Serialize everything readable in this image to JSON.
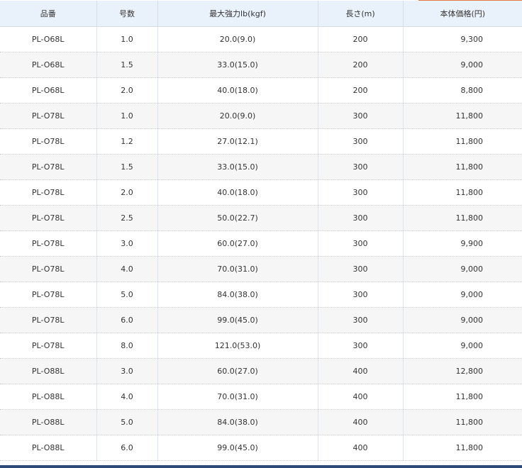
{
  "table": {
    "headers": [
      "品番",
      "号数",
      "最大強力lb(kgf)",
      "長さ(m)",
      "本体価格(円)"
    ],
    "rows": [
      [
        "PL-O68L",
        "1.0",
        "20.0(9.0)",
        "200",
        "9,300"
      ],
      [
        "PL-O68L",
        "1.5",
        "33.0(15.0)",
        "200",
        "9,000"
      ],
      [
        "PL-O68L",
        "2.0",
        "40.0(18.0)",
        "200",
        "8,800"
      ],
      [
        "PL-O78L",
        "1.0",
        "20.0(9.0)",
        "300",
        "11,800"
      ],
      [
        "PL-O78L",
        "1.2",
        "27.0(12.1)",
        "300",
        "11,800"
      ],
      [
        "PL-O78L",
        "1.5",
        "33.0(15.0)",
        "300",
        "11,800"
      ],
      [
        "PL-O78L",
        "2.0",
        "40.0(18.0)",
        "300",
        "11,800"
      ],
      [
        "PL-O78L",
        "2.5",
        "50.0(22.7)",
        "300",
        "11,800"
      ],
      [
        "PL-O78L",
        "3.0",
        "60.0(27.0)",
        "300",
        "9,900"
      ],
      [
        "PL-O78L",
        "4.0",
        "70.0(31.0)",
        "300",
        "9,000"
      ],
      [
        "PL-O78L",
        "5.0",
        "84.0(38.0)",
        "300",
        "9,000"
      ],
      [
        "PL-O78L",
        "6.0",
        "99.0(45.0)",
        "300",
        "9,000"
      ],
      [
        "PL-O78L",
        "8.0",
        "121.0(53.0)",
        "300",
        "9,000"
      ],
      [
        "PL-O88L",
        "3.0",
        "60.0(27.0)",
        "400",
        "12,800"
      ],
      [
        "PL-O88L",
        "4.0",
        "70.0(31.0)",
        "400",
        "11,800"
      ],
      [
        "PL-O88L",
        "5.0",
        "84.0(38.0)",
        "400",
        "11,800"
      ],
      [
        "PL-O88L",
        "6.0",
        "99.0(45.0)",
        "400",
        "11,800"
      ]
    ]
  },
  "colors": {
    "header_bg": "#e9f1fa",
    "alt_row_bg": "#f6f6f6",
    "top_accent": "#e8743b",
    "bottom_bar": "#2d4a78"
  }
}
